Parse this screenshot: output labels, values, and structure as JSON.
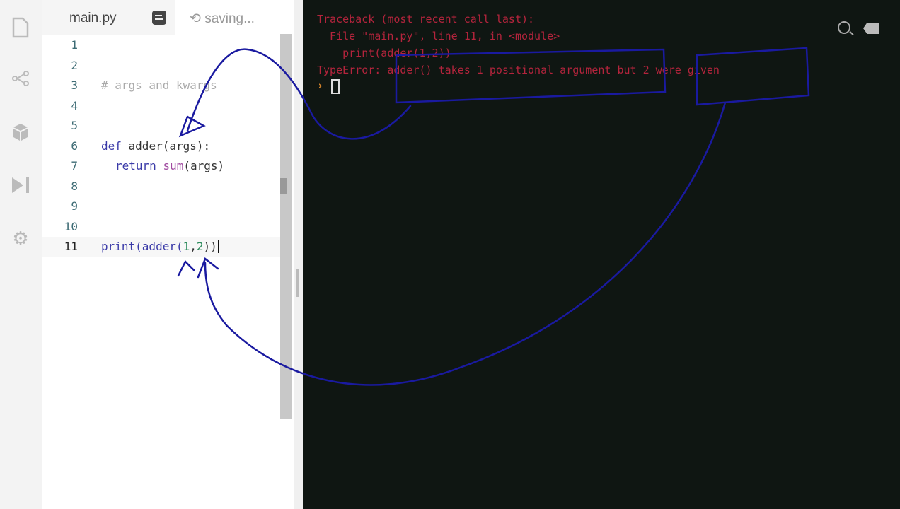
{
  "tab": {
    "filename": "main.py",
    "status": "saving..."
  },
  "sidebar": {
    "icons": [
      "file-icon",
      "share-icon",
      "packages-icon",
      "debugger-icon",
      "settings-icon"
    ]
  },
  "editor": {
    "line_numbers": [
      "1",
      "2",
      "3",
      "4",
      "5",
      "6",
      "7",
      "8",
      "9",
      "10",
      "11"
    ],
    "line3": "# args and kwargs",
    "line6_kw": "def",
    "line6_rest": " adder(args):",
    "line7_kw": "return",
    "line7_fn": "sum",
    "line7_rest": "(args)",
    "line11_a": "print(adder(",
    "line11_n1": "1",
    ",": ",",
    "line11_n2": "2",
    "line11_b": "))"
  },
  "terminal": {
    "lines": [
      "Traceback (most recent call last):",
      "  File \"main.py\", line 11, in <module>",
      "    print(adder(1,2))",
      "TypeError: adder() takes 1 positional argument but 2 were given"
    ],
    "prompt": "›"
  },
  "colors": {
    "terminal_bg": "#0f1612",
    "error_text": "#b3243c",
    "annotation_ink": "#1a1aa0"
  }
}
